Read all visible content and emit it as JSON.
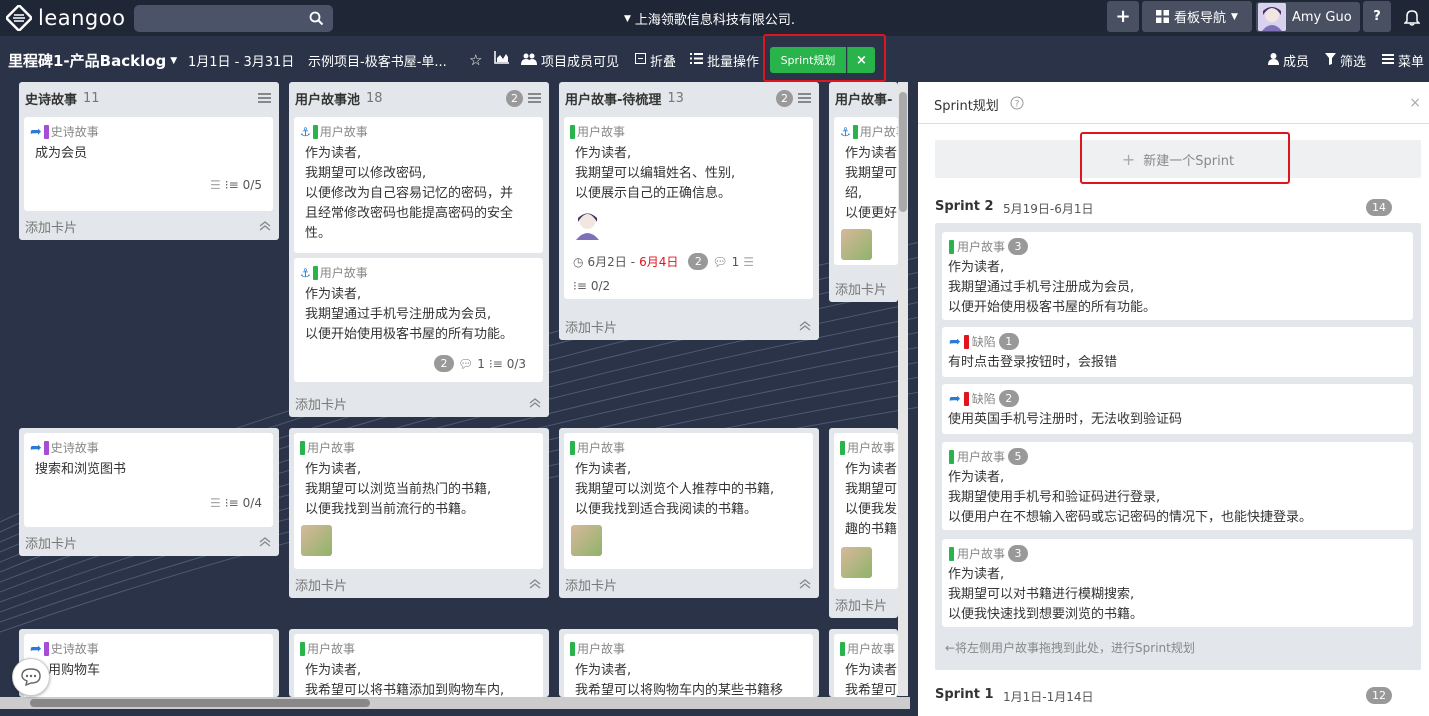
{
  "topbar": {
    "logo_text": "leangoo",
    "search_placeholder": "",
    "company": "上海领歌信息科技有限公司.",
    "add_label": "+",
    "board_nav": "看板导航",
    "user_name": "Amy Guo",
    "help": "?"
  },
  "toolbar": {
    "board_title": "里程碑1-产品Backlog",
    "date_range": "1月1日 - 3月31日",
    "project": "示例项目-极客书屋-单...",
    "visibility": "项目成员可见",
    "collapse": "折叠",
    "batch": "批量操作",
    "sprint_plan": "Sprint规划",
    "sprint_close": "×",
    "members": "成员",
    "filter": "筛选",
    "menu": "菜单"
  },
  "common": {
    "add_card": "添加卡片",
    "type_story": "用户故事",
    "type_epic": "史诗故事",
    "type_bug": "缺陷"
  },
  "lists": [
    {
      "title": "史诗故事",
      "count": "11"
    },
    {
      "title": "用户故事池",
      "count": "18",
      "badge": "2"
    },
    {
      "title": "用户故事-待梳理",
      "count": "13",
      "badge": "2"
    },
    {
      "title": "用户故事-"
    }
  ],
  "cards": {
    "epic1": {
      "text": "成为会员",
      "checklist": "0/5"
    },
    "epic2": {
      "text": "搜索和浏览图书",
      "checklist": "0/4"
    },
    "epic3": {
      "text": "用购物车"
    },
    "pool1": {
      "l1": "作为读者,",
      "l2": "我期望可以修改密码,",
      "l3": "以便修改为自己容易记忆的密码，并",
      "l4": "且经常修改密码也能提高密码的安全",
      "l5": "性。"
    },
    "pool2": {
      "l1": "作为读者,",
      "l2": "我期望通过手机号注册成为会员,",
      "l3": "以便开始使用极客书屋的所有功能。",
      "badge": "2",
      "comments": "1",
      "checklist": "0/3"
    },
    "pool3": {
      "l1": "作为读者,",
      "l2": "我期望可以浏览当前热门的书籍,",
      "l3": "以便我找到当前流行的书籍。"
    },
    "pool4": {
      "l1": "作为读者,",
      "l2": "我希望可以将书籍添加到购物车内,"
    },
    "groom1": {
      "l1": "作为读者,",
      "l2": "我期望可以编辑姓名、性别,",
      "l3": "以便展示自己的正确信息。",
      "date_start": "6月2日",
      "date_sep": " - ",
      "date_end": "6月4日",
      "badge": "2",
      "comments": "1",
      "checklist": "0/2"
    },
    "groom2": {
      "l1": "作为读者,",
      "l2": "我期望可以浏览个人推荐中的书籍,",
      "l3": "以便我找到适合我阅读的书籍。"
    },
    "groom3": {
      "l1": "作为读者,",
      "l2": "我希望可以将购物车内的某些书籍移"
    },
    "col4a": {
      "l1": "作为读者",
      "l2": "我期望可",
      "l3": "绍,",
      "l4": "以便更好"
    },
    "col4b": {
      "l1": "作为读者",
      "l2": "我期望可",
      "l3": "以便我发",
      "l4": "趣的书籍"
    },
    "col4c": {
      "l1": "作为读者",
      "l2": "我希望可"
    }
  },
  "panel": {
    "title": "Sprint规划",
    "close": "×",
    "new_sprint": "新建一个Sprint",
    "sprint2": {
      "name": "Sprint 2",
      "dates": "5月19日-6月1日",
      "count": "14"
    },
    "sprint1": {
      "name": "Sprint 1",
      "dates": "1月1日-1月14日",
      "count": "12"
    },
    "drag_hint": "←将左侧用户故事拖拽到此处，进行Sprint规划",
    "items": [
      {
        "type": "用户故事",
        "badge": "3",
        "l1": "作为读者,",
        "l2": "我期望通过手机号注册成为会员,",
        "l3": "以便开始使用极客书屋的所有功能。"
      },
      {
        "type": "缺陷",
        "badge": "1",
        "l1": "有时点击登录按钮时，会报错"
      },
      {
        "type": "缺陷",
        "badge": "2",
        "l1": "使用英国手机号注册时，无法收到验证码"
      },
      {
        "type": "用户故事",
        "badge": "5",
        "l1": "作为读者,",
        "l2": "我期望使用手机号和验证码进行登录,",
        "l3": "以便用户在不想输入密码或忘记密码的情况下，也能快捷登录。"
      },
      {
        "type": "用户故事",
        "badge": "3",
        "l1": "作为读者,",
        "l2": "我期望可以对书籍进行模糊搜索,",
        "l3": "以便我快速找到想要浏览的书籍。"
      }
    ]
  },
  "colors": {
    "green": "#28b44b",
    "purple": "#a64cd6",
    "red": "#e0141e",
    "topbar": "#1f2636",
    "board": "#2a3348"
  }
}
